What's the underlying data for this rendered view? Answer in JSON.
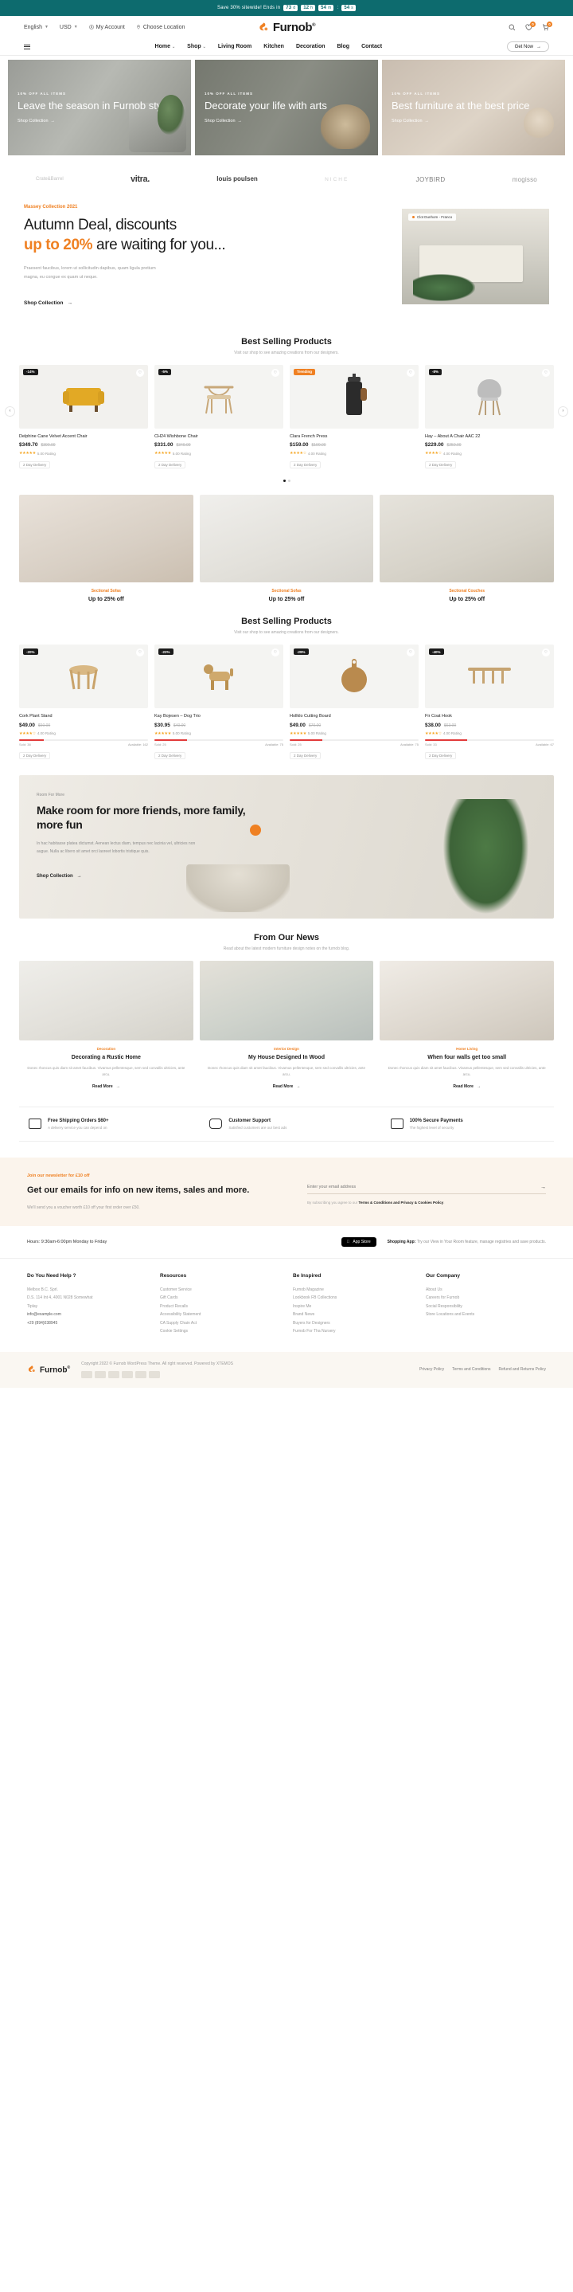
{
  "announcement": {
    "text": "Save 30% sitewide! Ends in",
    "days": "73",
    "days_unit": "d",
    "hours": "12",
    "hours_unit": "h",
    "minutes": "54",
    "minutes_unit": "m",
    "separator": ":",
    "seconds": "54",
    "seconds_unit": "s"
  },
  "utility": {
    "language": "English",
    "currency": "USD",
    "account": "My Account",
    "location": "Choose Location",
    "wishlist_count": "0",
    "cart_count": "0"
  },
  "brand": {
    "name": "Furnob",
    "suffix": "®"
  },
  "nav": {
    "items": [
      {
        "label": "Home",
        "caret": "⌄"
      },
      {
        "label": "Shop",
        "caret": "⌄"
      },
      {
        "label": "Living Room",
        "caret": ""
      },
      {
        "label": "Kitchen",
        "caret": ""
      },
      {
        "label": "Decoration",
        "caret": ""
      },
      {
        "label": "Blog",
        "caret": ""
      },
      {
        "label": "Contact",
        "caret": ""
      }
    ],
    "cta": "Get Now"
  },
  "hero": [
    {
      "kicker": "10% OFF ALL ITEMS",
      "title": "Leave the season in Furnob style",
      "cta": "Shop Collection"
    },
    {
      "kicker": "10% OFF ALL ITEMS",
      "title": "Decorate your life with arts",
      "cta": "Shop Collection"
    },
    {
      "kicker": "10% OFF ALL ITEMS",
      "title": "Best furniture at the best price",
      "cta": "Shop Collection"
    }
  ],
  "brands": [
    {
      "name": "Crate&Barrel"
    },
    {
      "name": "vitra."
    },
    {
      "name": "louis poulsen"
    },
    {
      "name": "NICHE"
    },
    {
      "name": "JOYBIRD"
    },
    {
      "name": "mogisso"
    }
  ],
  "deal": {
    "kicker": "Massey Collection 2021",
    "title_1": "Autumn Deal, discounts",
    "title_accent": "up to 20%",
    "title_2": "are waiting for you...",
    "body": "Praesent faucibus, lorem ut sollicitudin dapibus, quam ligula pretium magna, eu congue ex quam ut neque.",
    "cta": "Shop Collection",
    "image_tag": "Clot Dunhom - Franco"
  },
  "best_selling_1": {
    "title": "Best Selling Products",
    "subtitle": "Visit our shop to see amazing creations from our designers.",
    "products": [
      {
        "badge": "-14%",
        "badge_kind": "dark",
        "name": "Delphine Cane Velvet Accent Chair",
        "price": "$349.70",
        "old_price": "$390.00",
        "stars": "★★★★★",
        "rating": "5.00 Rating",
        "shipping": "2 Day Delivery"
      },
      {
        "badge": "-5%",
        "badge_kind": "dark",
        "name": "CH24 Wishbone Chair",
        "price": "$331.00",
        "old_price": "$349.00",
        "stars": "★★★★★",
        "rating": "5.00 Rating",
        "shipping": "2 Day Delivery"
      },
      {
        "badge": "Trending",
        "badge_kind": "trend",
        "name": "Clara French Press",
        "price": "$159.00",
        "old_price": "$190.00",
        "stars": "★★★★☆",
        "rating": "4.00 Rating",
        "shipping": "2 Day Delivery"
      },
      {
        "badge": "-8%",
        "badge_kind": "dark",
        "name": "Hay – About A Chair AAC 22",
        "price": "$229.00",
        "old_price": "$250.00",
        "stars": "★★★★☆",
        "rating": "4.00 Rating",
        "shipping": "2 Day Delivery"
      }
    ],
    "dots": [
      "on",
      "off"
    ]
  },
  "categories": [
    {
      "label": "Sectional Sofas",
      "title": "Up to 25% off"
    },
    {
      "label": "Sectional Sofas",
      "title": "Up to 25% off"
    },
    {
      "label": "Sectional Couches",
      "title": "Up to 25% off"
    }
  ],
  "best_selling_2": {
    "title": "Best Selling Products",
    "subtitle": "Visit our shop to see amazing creations from our designers.",
    "products": [
      {
        "badge": "-20%",
        "badge_kind": "dark",
        "name": "Cork Plant Stand",
        "price": "$49.00",
        "old_price": "$60.00",
        "stars": "★★★★☆",
        "rating": "4.00 Rating",
        "sold_label": "Sold: 38",
        "left_label": "Available: 162",
        "bar_pct": 19,
        "shipping": "2 Day Delivery"
      },
      {
        "badge": "-22%",
        "badge_kind": "dark",
        "name": "Kay Bojesen – Dog Trio",
        "price": "$30.95",
        "old_price": "$40.00",
        "stars": "★★★★★",
        "rating": "5.00 Rating",
        "sold_label": "Sold: 25",
        "left_label": "Available: 75",
        "bar_pct": 25,
        "shipping": "2 Day Delivery"
      },
      {
        "badge": "-29%",
        "badge_kind": "dark",
        "name": "Hollklo Cutting Board",
        "price": "$49.00",
        "old_price": "$70.00",
        "stars": "★★★★★",
        "rating": "5.00 Rating",
        "sold_label": "Sold: 25",
        "left_label": "Available: 75",
        "bar_pct": 25,
        "shipping": "2 Day Delivery"
      },
      {
        "badge": "-40%",
        "badge_kind": "dark",
        "name": "Fir Coat Hook",
        "price": "$38.00",
        "old_price": "$63.00",
        "stars": "★★★★☆",
        "rating": "4.00 Rating",
        "sold_label": "Sold: 33",
        "left_label": "Available: 67",
        "bar_pct": 33,
        "shipping": "2 Day Delivery"
      }
    ]
  },
  "room": {
    "kicker": "Room For More",
    "title": "Make room for more friends, more family, more fun",
    "body": "In hac habitasse platea dictumst. Aenean lectus diam, tempus nec lacinia vel, ultricies non augue. Nulla ac libero sit amet orci laoreet lobortis tristique quis.",
    "cta": "Shop Collection"
  },
  "news": {
    "title": "From Our News",
    "subtitle": "Read about the latest modern furniture design notes on the furnob blog.",
    "posts": [
      {
        "category": "Decoration",
        "title": "Decorating a Rustic Home",
        "excerpt": "Donec rhoncus quis diam sit amet faucibus. Vivamus pellentesque, sem sed convallis ultricies, ante arcu.",
        "read": "Read More"
      },
      {
        "category": "Interior Design",
        "title": "My House Designed In Wood",
        "excerpt": "Donec rhoncus quis diam sit amet faucibus. Vivamus pellentesque, sem sed convallis ultricies, ante arcu.",
        "read": "Read More"
      },
      {
        "category": "Home Living",
        "title": "When four walls get too small",
        "excerpt": "Donec rhoncus quis diam sit amet faucibus. Vivamus pellentesque, sem sed convallis ultricies, ante arcu.",
        "read": "Read More"
      }
    ]
  },
  "features": [
    {
      "icon": "truck-icon",
      "title": "Free Shipping Orders $60+",
      "sub": "A delivery service you can depend on"
    },
    {
      "icon": "phone-icon",
      "title": "Customer Support",
      "sub": "Satisfied customers are our best ads"
    },
    {
      "icon": "card-icon",
      "title": "100% Secure Payments",
      "sub": "The highest level of security"
    }
  ],
  "newsletter": {
    "tag": "Join our newsletter for £10 off",
    "title": "Get our emails for info on new items, sales and more.",
    "body": "We'll send you a voucher worth £10 off your first order over £50.",
    "placeholder": "Enter your email address",
    "submit": "→",
    "note_pre": "By subscribing you agree to our ",
    "note_bold": "Terms & Conditions and Privacy & Cookies Policy",
    "note_post": "."
  },
  "hours": {
    "text": "Hours: 9:30am-6:00pm Monday to Friday",
    "app_label_top": "Available on the",
    "app_label": "App Store",
    "shopping_app_pre": "Shopping App: ",
    "shopping_app_text": "Try our View in Your Room feature, manage registries and save products."
  },
  "footer": {
    "columns": [
      {
        "title": "Do You Need Help ?",
        "lines": [
          "Melbox B.C. Sprl.",
          "D.S. 114 Int 4, 4001 N028 Somewhat",
          "Tiplay",
          "info@example.com",
          "+29 (894)038945"
        ]
      },
      {
        "title": "Resources",
        "lines": [
          "Customer Service",
          "Gift Cards",
          "Product Recalls",
          "Accessibility Statement",
          "CA Supply Chain Act",
          "Cookie Settings"
        ]
      },
      {
        "title": "Be Inspired",
        "lines": [
          "Furnob Magazine",
          "Lookbook FB Collections",
          "Inspire Me",
          "Brand News",
          "Buyers for Designers",
          "Furnob For Tha Nursery"
        ]
      },
      {
        "title": "Our Company",
        "lines": [
          "About Us",
          "Careers for Furnob",
          "Social Responsibility",
          "Store Locations and Events"
        ]
      }
    ]
  },
  "bottom": {
    "copyright": "Copyright 2022 © Furnob WordPress Theme. All right reserved. Powered by XTEMOS",
    "links": [
      "Privacy Policy",
      "Terms and Conditions",
      "Refund and Returns Policy"
    ]
  }
}
